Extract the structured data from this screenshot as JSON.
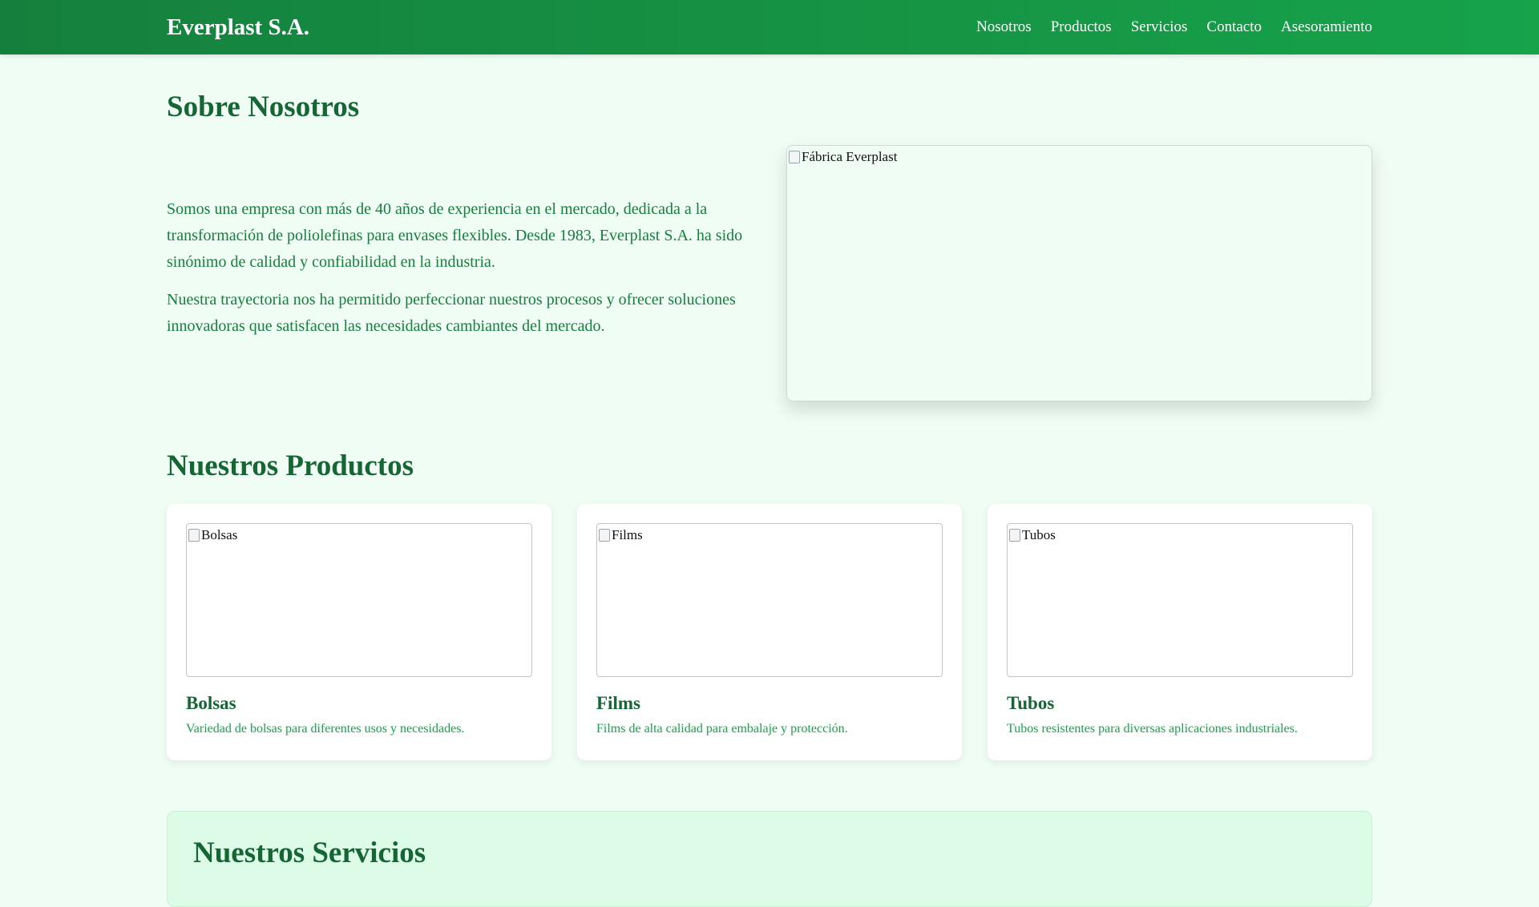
{
  "nav": {
    "brand": "Everplast S.A.",
    "links": [
      "Nosotros",
      "Productos",
      "Servicios",
      "Contacto",
      "Asesoramiento"
    ]
  },
  "about": {
    "title": "Sobre Nosotros",
    "paragraphs": [
      "Somos una empresa con más de 40 años de experiencia en el mercado, dedicada a la transformación de poliolefinas para envases flexibles. Desde 1983, Everplast S.A. ha sido sinónimo de calidad y confiabilidad en la industria.",
      "Nuestra trayectoria nos ha permitido perfeccionar nuestros procesos y ofrecer soluciones innovadoras que satisfacen las necesidades cambiantes del mercado."
    ],
    "image_alt": "Fábrica Everplast"
  },
  "products": {
    "title": "Nuestros Productos",
    "items": [
      {
        "name": "Bolsas",
        "image_alt": "Bolsas",
        "description": "Variedad de bolsas para diferentes usos y necesidades."
      },
      {
        "name": "Films",
        "image_alt": "Films",
        "description": "Films de alta calidad para embalaje y protección."
      },
      {
        "name": "Tubos",
        "image_alt": "Tubos",
        "description": "Tubos resistentes para diversas aplicaciones industriales."
      }
    ]
  },
  "services": {
    "title": "Nuestros Servicios"
  },
  "colors": {
    "nav_start": "#15803d",
    "nav_end": "#16a34a",
    "heading": "#166534",
    "body_text": "#15803d",
    "page_bg": "#f0fdf4",
    "services_bg": "#dcfce7"
  }
}
